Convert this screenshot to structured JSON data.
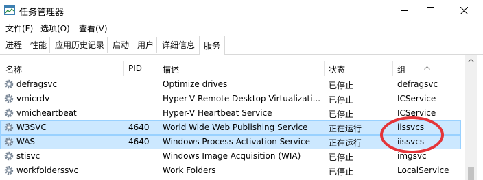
{
  "window": {
    "title": "任务管理器",
    "icon": "task-manager-icon",
    "controls": [
      "minimize-icon",
      "maximize-icon",
      "close-icon"
    ]
  },
  "menu": {
    "file": "文件(F)",
    "options": "选项(O)",
    "view": "查看(V)"
  },
  "tabs": {
    "processes": "进程",
    "performance": "性能",
    "app_history": "应用历史记录",
    "startup": "启动",
    "users": "用户",
    "details": "详细信息",
    "services": "服务",
    "active": "services"
  },
  "table": {
    "headers": {
      "name": "名称",
      "pid": "PID",
      "description": "描述",
      "status": "状态",
      "group": "组"
    },
    "sort": "group-ascending",
    "rows": [
      {
        "name": "defragsvc",
        "pid": "",
        "description": "Optimize drives",
        "status": "已停止",
        "group": "defragsvc",
        "selected": false
      },
      {
        "name": "vmicrdv",
        "pid": "",
        "description": "Hyper-V Remote Desktop Virtualizati...",
        "status": "已停止",
        "group": "ICService",
        "selected": false
      },
      {
        "name": "vmicheartbeat",
        "pid": "",
        "description": "Hyper-V Heartbeat Service",
        "status": "已停止",
        "group": "ICService",
        "selected": false
      },
      {
        "name": "W3SVC",
        "pid": "4640",
        "description": "World Wide Web Publishing Service",
        "status": "正在运行",
        "group": "iissvcs",
        "selected": true
      },
      {
        "name": "WAS",
        "pid": "4640",
        "description": "Windows Process Activation Service",
        "status": "正在运行",
        "group": "iissvcs",
        "selected": true
      },
      {
        "name": "stisvc",
        "pid": "",
        "description": "Windows Image Acquisition (WIA)",
        "status": "已停止",
        "group": "imgsvc",
        "selected": false
      },
      {
        "name": "workfolderssvc",
        "pid": "",
        "description": "Work Folders",
        "status": "已停止",
        "group": "LocalService",
        "selected": false
      }
    ]
  },
  "colors": {
    "selection": "#cce8ff",
    "annotation": "#e4353a"
  }
}
